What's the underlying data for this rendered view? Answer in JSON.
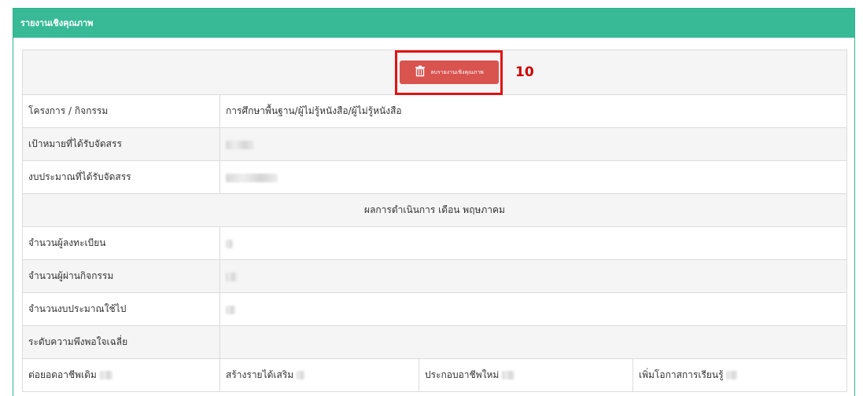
{
  "panel": {
    "title": "รายงานเชิงคุณภาพ"
  },
  "delete_button": {
    "label": "ลบรายงานเชิงคุณภาพ"
  },
  "callout_number": "10",
  "rows": {
    "project": {
      "label": "โครงการ / กิจกรรม",
      "value": "การศึกษาพื้นฐาน/ผู้ไม่รู้หนังสือ/ผู้ไม่รู้หนังสือ"
    },
    "target": {
      "label": "เป้าหมายที่ได้รับจัดสรร"
    },
    "budget": {
      "label": "งบประมาณที่ได้รับจัดสรร"
    },
    "results_header": "ผลการดำเนินการ เดือน พฤษภาคม",
    "registered": {
      "label": "จำนวนผู้ลงทะเบียน"
    },
    "passed": {
      "label": "จำนวนผู้ผ่านกิจกรรม"
    },
    "spent": {
      "label": "จำนวนงบประมาณใช้ไป"
    },
    "satisfaction": {
      "label": "ระดับความพึงพอใจเฉลี่ย"
    },
    "outcomes": {
      "extend_career": "ต่อยอดอาชีพเดิม",
      "extra_income": "สร้างรายได้เสริม",
      "new_career": "ประกอบอาชีพใหม่",
      "learning_opportunity": "เพิ่มโอกาสการเรียนรู้"
    }
  },
  "colors": {
    "header": "#38ba97",
    "danger": "#d9534f",
    "highlight": "#e31212"
  }
}
